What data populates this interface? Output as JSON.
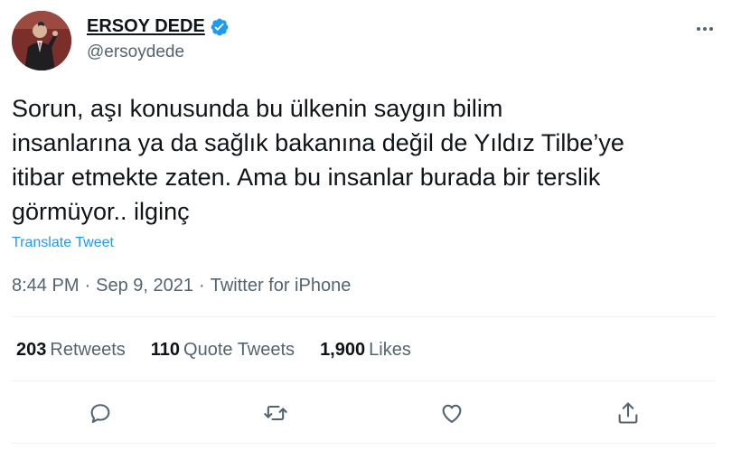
{
  "author": {
    "display_name": "ERSOY DEDE",
    "handle": "@ersoydede",
    "verified": true,
    "avatar_icon": "profile-photo"
  },
  "tweet": {
    "text": "Sorun, aşı konusunda bu ülkenin saygın bilim\ninsanlarına ya da sağlık bakanına değil de Yıldız Tilbe’ye\nitibar etmekte zaten. Ama bu insanlar burada bir terslik\ngörmüyor.. ilginç",
    "translate_label": "Translate Tweet",
    "time": "8:44 PM",
    "date": "Sep 9, 2021",
    "source": "Twitter for iPhone",
    "separator": "·"
  },
  "stats": {
    "retweets": {
      "count": "203",
      "label": "Retweets"
    },
    "quotes": {
      "count": "110",
      "label": "Quote Tweets"
    },
    "likes": {
      "count": "1,900",
      "label": "Likes"
    }
  },
  "actions": [
    "reply-icon",
    "retweet-icon",
    "like-icon",
    "share-icon"
  ],
  "colors": {
    "text": "#0f1419",
    "secondary": "#536471",
    "link": "#1d9bf0",
    "divider": "#eff3f4",
    "verified": "#1d9bf0"
  }
}
